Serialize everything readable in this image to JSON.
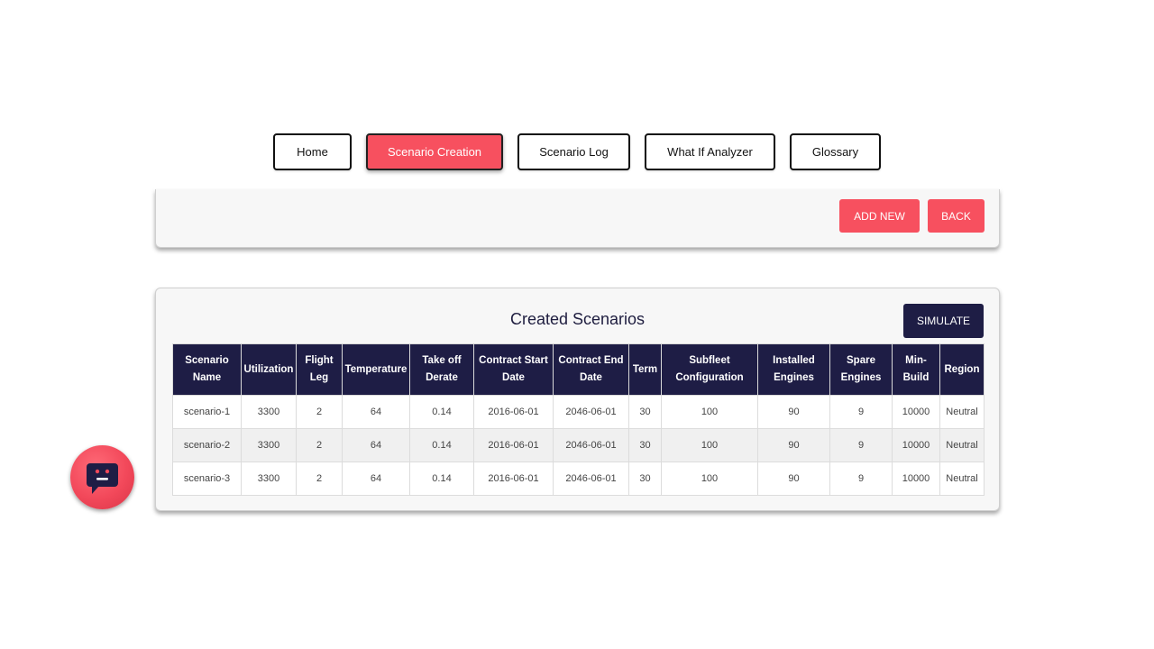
{
  "nav": {
    "items": [
      {
        "label": "Home"
      },
      {
        "label": "Scenario Creation"
      },
      {
        "label": "Scenario Log"
      },
      {
        "label": "What If Analyzer"
      },
      {
        "label": "Glossary"
      }
    ],
    "active": "Scenario Creation"
  },
  "top_panel": {
    "add_new_label": "ADD NEW",
    "back_label": "BACK"
  },
  "scenarios": {
    "title": "Created Scenarios",
    "simulate_label": "SIMULATE",
    "columns": [
      "Scenario Name",
      "Utilization",
      "Flight Leg",
      "Temperature",
      "Take off Derate",
      "Contract Start Date",
      "Contract End Date",
      "Term",
      "Subfleet Configuration",
      "Installed Engines",
      "Spare Engines",
      "Min-Build",
      "Region"
    ],
    "rows": [
      [
        "scenario-1",
        "3300",
        "2",
        "64",
        "0.14",
        "2016-06-01",
        "2046-06-01",
        "30",
        "100",
        "90",
        "9",
        "10000",
        "Neutral"
      ],
      [
        "scenario-2",
        "3300",
        "2",
        "64",
        "0.14",
        "2016-06-01",
        "2046-06-01",
        "30",
        "100",
        "90",
        "9",
        "10000",
        "Neutral"
      ],
      [
        "scenario-3",
        "3300",
        "2",
        "64",
        "0.14",
        "2016-06-01",
        "2046-06-01",
        "30",
        "100",
        "90",
        "9",
        "10000",
        "Neutral"
      ]
    ]
  },
  "chat": {
    "icon": "chat-bot-icon"
  },
  "colors": {
    "accent_red": "#f7505f",
    "navy": "#1e1d45"
  }
}
